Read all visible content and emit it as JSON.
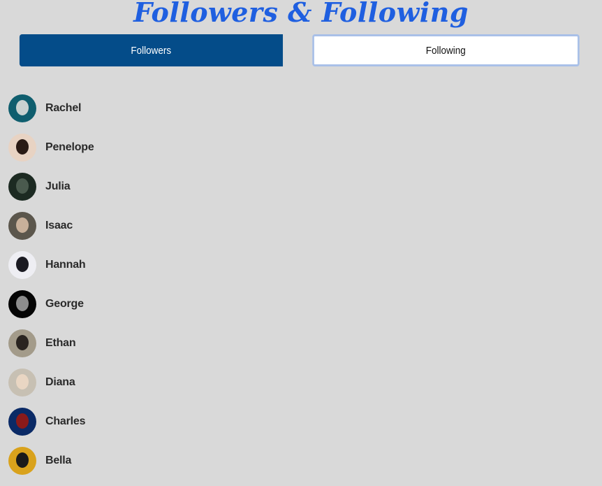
{
  "title": "Followers & Following",
  "tabs": [
    {
      "label": "Followers",
      "active": true
    },
    {
      "label": "Following",
      "active": false
    }
  ],
  "colors": {
    "background": "#d9d9d9",
    "title": "#1f5fe0",
    "active_tab": "#044c89",
    "inactive_tab": "#ffffff",
    "inactive_tab_border": "#a9c0e8"
  },
  "followers": [
    {
      "name": "Rachel",
      "avatar_bg": "#0f5e6e",
      "avatar_fg": "#c9d2d0"
    },
    {
      "name": "Penelope",
      "avatar_bg": "#e8d3c3",
      "avatar_fg": "#2a1a14"
    },
    {
      "name": "Julia",
      "avatar_bg": "#1c2a22",
      "avatar_fg": "#4a5a4e"
    },
    {
      "name": "Isaac",
      "avatar_bg": "#5b564c",
      "avatar_fg": "#c8b09a"
    },
    {
      "name": "Hannah",
      "avatar_bg": "#eeeef3",
      "avatar_fg": "#1a1a22"
    },
    {
      "name": "George",
      "avatar_bg": "#050505",
      "avatar_fg": "#8d8d8d"
    },
    {
      "name": "Ethan",
      "avatar_bg": "#a39b8a",
      "avatar_fg": "#2a2420"
    },
    {
      "name": "Diana",
      "avatar_bg": "#c7c0b3",
      "avatar_fg": "#e9d6c3"
    },
    {
      "name": "Charles",
      "avatar_bg": "#0a2a66",
      "avatar_fg": "#8a1a1a"
    },
    {
      "name": "Bella",
      "avatar_bg": "#d9a21c",
      "avatar_fg": "#1a1a1a"
    }
  ]
}
